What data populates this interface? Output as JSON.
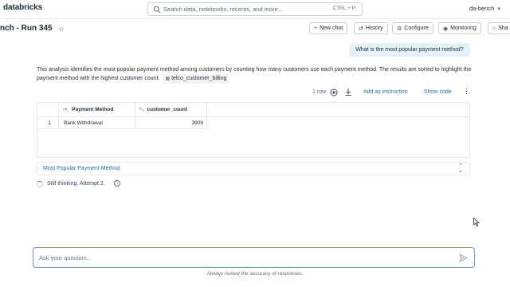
{
  "topbar": {
    "logo": "databricks",
    "search_placeholder": "Search data, notebooks, recents, and more...",
    "search_shortcut": "CTRL + P",
    "user": "da-bench"
  },
  "header": {
    "title": "nch - Run 345",
    "buttons": {
      "new_chat": "New chat",
      "history": "History",
      "configure": "Configure",
      "monitoring": "Monitoring",
      "share": "Sha"
    }
  },
  "chat": {
    "user_message": "What is the most popular payment method?",
    "description": "This analysis identifies the most popular payment method among customers by counting how many customers use each payment method. The results are sorted to highlight the payment method with the highest customer count.",
    "table_ref": "telco_customer_billing",
    "result": {
      "row_count": "1 row",
      "add_instruction": "Add as instruction",
      "show_code": "Show code",
      "columns": [
        "Payment Method",
        "customer_count"
      ],
      "rows": [
        {
          "index": "1",
          "payment_method": "Bank Withdrawal",
          "customer_count": "3909"
        }
      ]
    },
    "accordion_label": "Most Popular Payment Method",
    "thinking": "Still thinking. Attempt 2."
  },
  "input": {
    "placeholder": "Ask your question...",
    "disclaimer": "Always review the accuracy of responses."
  },
  "colors": {
    "accent": "#2272b4",
    "bubble": "#e5f1f8",
    "input_border": "#5aa1d6"
  }
}
